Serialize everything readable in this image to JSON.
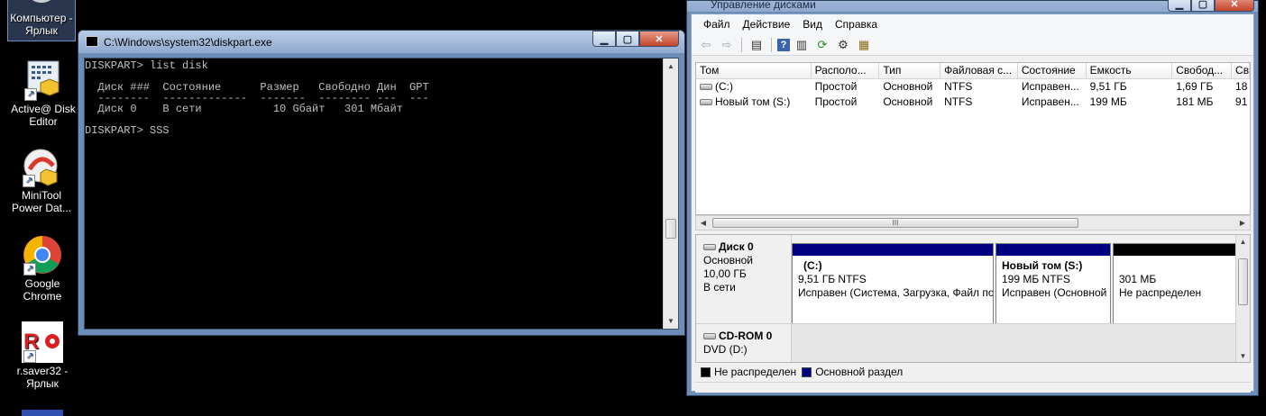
{
  "desktop": {
    "icons": [
      {
        "label": "Компьютер - Ярлык"
      },
      {
        "label": "Active@ Disk Editor"
      },
      {
        "label": "MiniTool Power Dat..."
      },
      {
        "label": "Google Chrome"
      },
      {
        "label": "r.saver32 - Ярлык"
      }
    ]
  },
  "cmd": {
    "title": "C:\\Windows\\system32\\diskpart.exe",
    "lines": [
      "DISKPART> list disk",
      "",
      "  Диск ###  Состояние      Размер   Свободно Дин  GPT",
      "  --------  -------------  -------  -------- ---  ---",
      "  Диск 0    В сети           10 Gбайт   301 Mбайт",
      "",
      "DISKPART> SSS"
    ]
  },
  "dm": {
    "title": "Управление дисками",
    "menu": [
      "Файл",
      "Действие",
      "Вид",
      "Справка"
    ],
    "toolbar_icons": [
      "back-arrow-icon",
      "forward-arrow-icon",
      "console-tree-icon",
      "help-icon",
      "properties-icon",
      "refresh-icon",
      "settings-icon",
      "export-icon"
    ],
    "columns": [
      "Том",
      "Располо...",
      "Тип",
      "Файловая с...",
      "Состояние",
      "Емкость",
      "Свобод...",
      "Сво"
    ],
    "volumes": [
      [
        "(C:)",
        "Простой",
        "Основной",
        "NTFS",
        "Исправен...",
        "9,51 ГБ",
        "1,69 ГБ",
        "18"
      ],
      [
        "Новый том (S:)",
        "Простой",
        "Основной",
        "NTFS",
        "Исправен...",
        "199 МБ",
        "181 МБ",
        "91"
      ]
    ],
    "hscroll_glyph": "III",
    "disk0": {
      "name": "Диск 0",
      "type": "Основной",
      "size": "10,00 ГБ",
      "status": "В сети",
      "partitions": [
        {
          "name": "(C:)",
          "info": "9,51 ГБ NTFS",
          "status": "Исправен (Система, Загрузка, Файл по"
        },
        {
          "name": "Новый том  (S:)",
          "info": "199 МБ NTFS",
          "status": "Исправен (Основной"
        },
        {
          "name": "",
          "info": "301 МБ",
          "status": "Не распределен"
        }
      ]
    },
    "cdrom": {
      "name": "CD-ROM 0",
      "type": "DVD (D:)"
    },
    "legend": [
      {
        "label": "Не распределен",
        "color": "#000000"
      },
      {
        "label": "Основной раздел",
        "color": "#000080"
      }
    ],
    "colors": {
      "primary": "#000080",
      "unallocated": "#000000"
    }
  }
}
